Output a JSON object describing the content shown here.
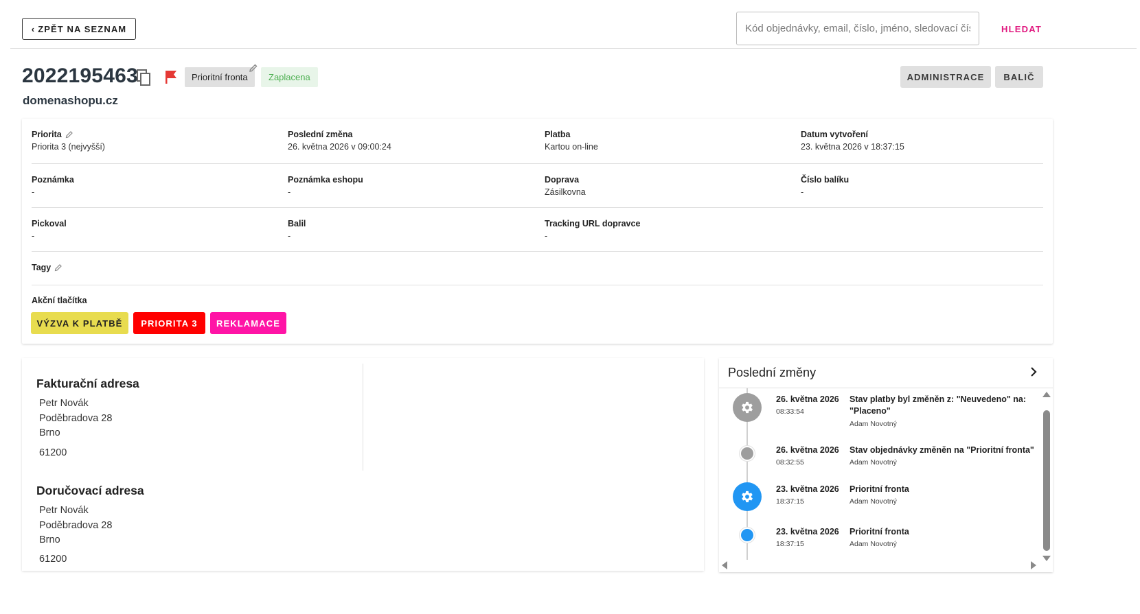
{
  "topbar": {
    "back_label": "ZPĚT NA SEZNAM",
    "search_placeholder": "Kód objednávky, email, číslo, jméno, sledovací číslo",
    "search_button": "HLEDAT"
  },
  "order": {
    "number": "2022195463",
    "queue": "Prioritní fronta",
    "payment_status": "Zaplacena",
    "shop": "domenashopu.cz",
    "admin_button": "ADMINISTRACE",
    "packer_button": "BALIČ"
  },
  "details": {
    "priority": {
      "label": "Priorita",
      "value": "Priorita 3 (nejvyšší)"
    },
    "last_change": {
      "label": "Poslední změna",
      "value": "26. května 2026 v 09:00:24"
    },
    "payment": {
      "label": "Platba",
      "value": "Kartou on-line"
    },
    "created": {
      "label": "Datum vytvoření",
      "value": "23. května 2026 v 18:37:15"
    },
    "note": {
      "label": "Poznámka",
      "value": "-"
    },
    "shop_note": {
      "label": "Poznámka eshopu",
      "value": "-"
    },
    "shipping": {
      "label": "Doprava",
      "value": "Zásilkovna"
    },
    "parcel_number": {
      "label": "Číslo balíku",
      "value": "-"
    },
    "picked_by": {
      "label": "Pickoval",
      "value": "-"
    },
    "packed_by": {
      "label": "Balil",
      "value": "-"
    },
    "tracking_url": {
      "label": "Tracking URL dopravce",
      "value": "-"
    },
    "tags": {
      "label": "Tagy"
    },
    "actions_label": "Akční tlačítka",
    "actions": [
      {
        "label": "VÝZVA K PLATBĚ",
        "bg": "#e8dc4f",
        "color": "#222222"
      },
      {
        "label": "PRIORITA 3",
        "bg": "#ff0000",
        "color": "#ffffff"
      },
      {
        "label": "REKLAMACE",
        "bg": "#ff14a6",
        "color": "#ffffff"
      }
    ]
  },
  "billing": {
    "title": "Fakturační adresa",
    "name": "Petr Novák",
    "street": "Poděbradova 28",
    "city": "Brno",
    "zip": "61200"
  },
  "delivery": {
    "title": "Doručovací adresa",
    "name": "Petr Novák",
    "street": "Poděbradova 28",
    "city": "Brno",
    "zip": "61200"
  },
  "changes": {
    "title": "Poslední změny",
    "items": [
      {
        "date": "26. května 2026",
        "time": "08:33:54",
        "text": "Stav platby byl změněn z: \"Neuvedeno\" na: \"Placeno\"",
        "user": "Adam Novotný",
        "icon": "gear-icon",
        "color": "#9e9e9e"
      },
      {
        "date": "26. května 2026",
        "time": "08:32:55",
        "text": "Stav objednávky změněn na \"Prioritní fronta\"",
        "user": "Adam Novotný",
        "icon": "dot",
        "color": "#9e9e9e"
      },
      {
        "date": "23. května 2026",
        "time": "18:37:15",
        "text": "Prioritní fronta",
        "user": "Adam Novotný",
        "icon": "gear-icon",
        "color": "#2196f3"
      },
      {
        "date": "23. května 2026",
        "time": "18:37:15",
        "text": "Prioritní fronta",
        "user": "Adam Novotný",
        "icon": "dot",
        "color": "#2196f3"
      }
    ]
  }
}
